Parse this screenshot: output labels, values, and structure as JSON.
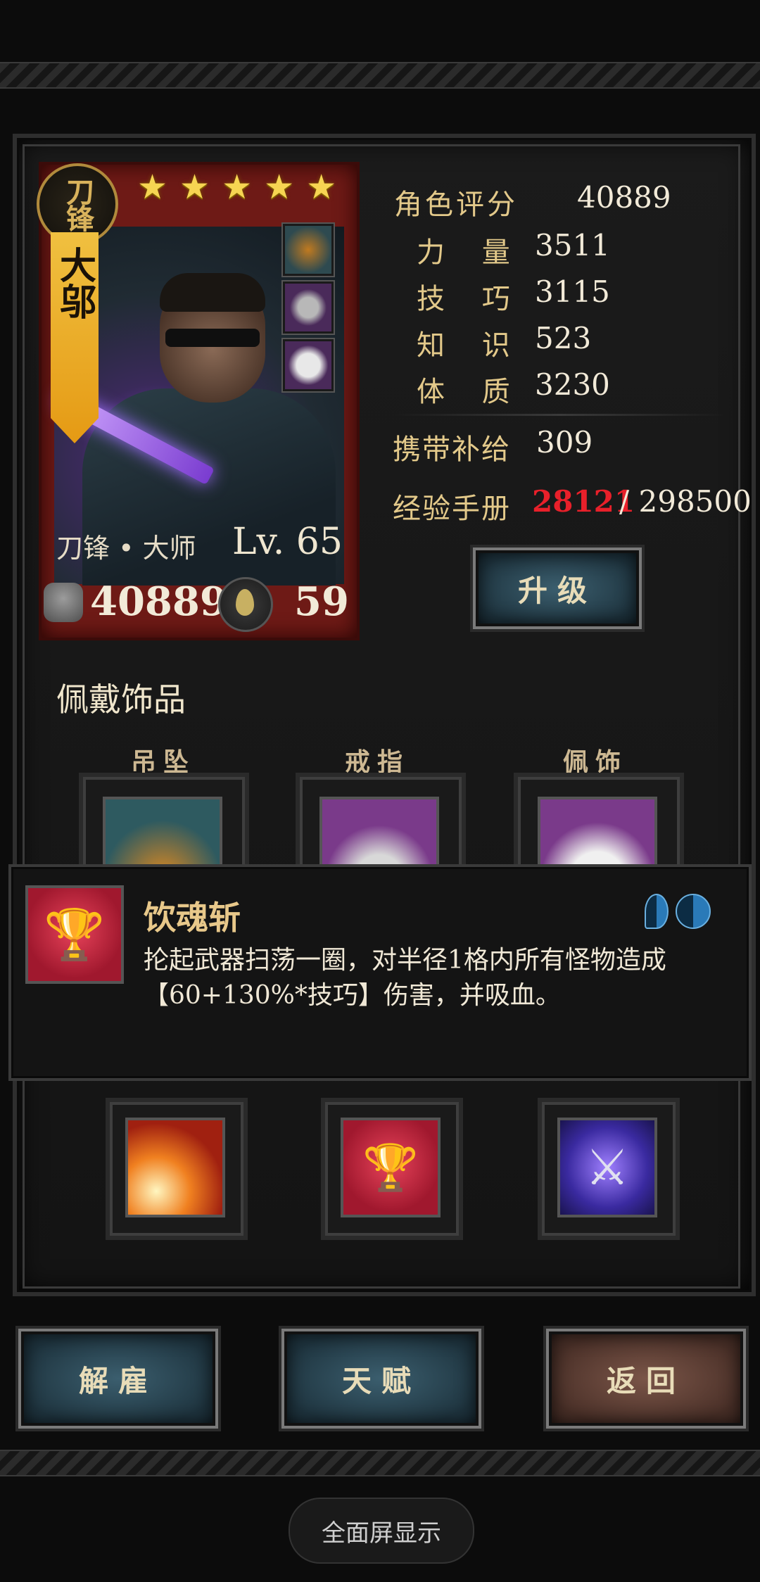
{
  "hero": {
    "class_badge": "刀锋",
    "name": "大邬",
    "stars": 5,
    "class_title": "刀锋 • 大师",
    "level": "Lv. 65",
    "power": "40889",
    "supply": "59"
  },
  "stats": {
    "rating_label": "角色评分",
    "rating_value": "40889",
    "strength_label": "力 量",
    "strength_value": "3511",
    "skill_label": "技 巧",
    "skill_value": "3115",
    "knowledge_label": "知 识",
    "knowledge_value": "523",
    "constitution_label": "体 质",
    "constitution_value": "3230",
    "carry_label": "携带补给",
    "carry_value": "309",
    "exp_label": "经验手册",
    "exp_current": "28121",
    "exp_total": "/ 298500"
  },
  "buttons": {
    "upgrade": "升级",
    "dismiss": "解雇",
    "talent": "天赋",
    "back": "返回"
  },
  "accessories": {
    "title": "佩戴饰品",
    "slots": [
      "吊坠",
      "戒指",
      "佩饰"
    ]
  },
  "skill_popup": {
    "name": "饮魂斩",
    "description": "抡起武器扫荡一圈，对半径1格内所有怪物造成【60+130%*技巧】伤害，并吸血。"
  },
  "system": {
    "fullscreen": "全面屏显示"
  },
  "colors": {
    "exp_current": "#e8202a",
    "stat_label": "#e3c98a",
    "card_red": "#6e1a16",
    "banner_gold": "#e59a14"
  }
}
